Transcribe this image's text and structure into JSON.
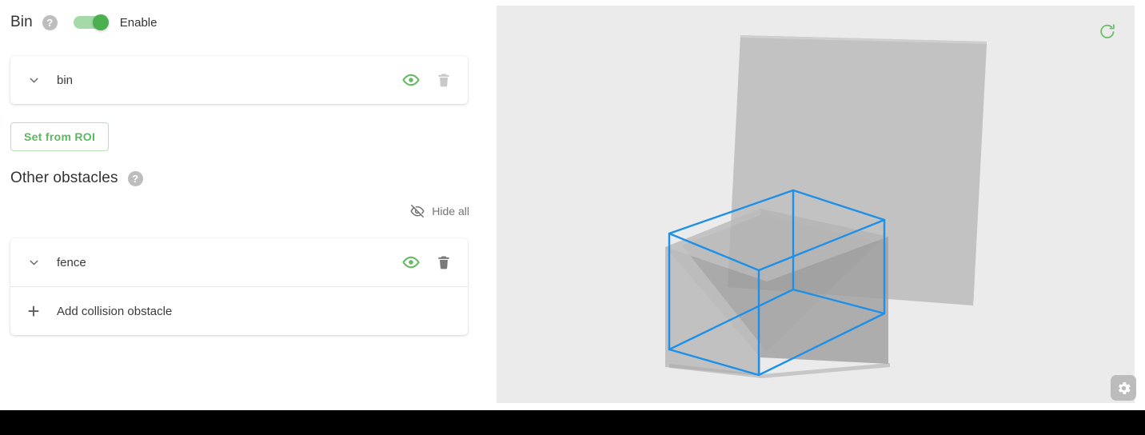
{
  "bin_section": {
    "title": "Bin",
    "help_icon": "help-circle-icon",
    "help_glyph": "?",
    "toggle": {
      "label": "Enable",
      "state": "on",
      "track_color": "#a5d9a8",
      "thumb_color": "#4caf50"
    },
    "items": [
      {
        "name": "bin",
        "chevron_icon": "chevron-down-icon",
        "visibility_icon": "eye-icon",
        "visibility_state": "visible",
        "visibility_color": "#64bb64",
        "delete_icon": "trash-icon",
        "delete_enabled": false,
        "delete_color": "#c9c9c9"
      }
    ],
    "roi_button": {
      "label": "Set from ROI",
      "text_color": "#5cb860",
      "border_color": "#b7e0b9"
    }
  },
  "other_obstacles_section": {
    "title": "Other obstacles",
    "help_icon": "help-circle-icon",
    "help_glyph": "?",
    "hide_all": {
      "label": "Hide all",
      "icon": "eye-off-icon",
      "color": "#757575"
    },
    "items": [
      {
        "name": "fence",
        "chevron_icon": "chevron-down-icon",
        "visibility_icon": "eye-icon",
        "visibility_state": "visible",
        "visibility_color": "#64bb64",
        "delete_icon": "trash-icon",
        "delete_enabled": true,
        "delete_color": "#7a7a7a"
      }
    ],
    "add_row": {
      "label": "Add collision obstacle",
      "icon": "plus-icon",
      "glyph": "+"
    }
  },
  "viewport": {
    "background_color": "#ebebeb",
    "reset_view_icon": "refresh-icon",
    "reset_view_color": "#6cbf6c",
    "settings_icon": "gear-icon",
    "settings_button_color": "#bcbcbc",
    "scene": {
      "bin_mesh_color": "#a8a8a8",
      "bin_wireframe_color": "#1e90e8",
      "fence_plane_color": "#bfbfbf",
      "objects": [
        "bin",
        "fence"
      ]
    }
  },
  "bottom_bar": {
    "color": "#000000"
  }
}
